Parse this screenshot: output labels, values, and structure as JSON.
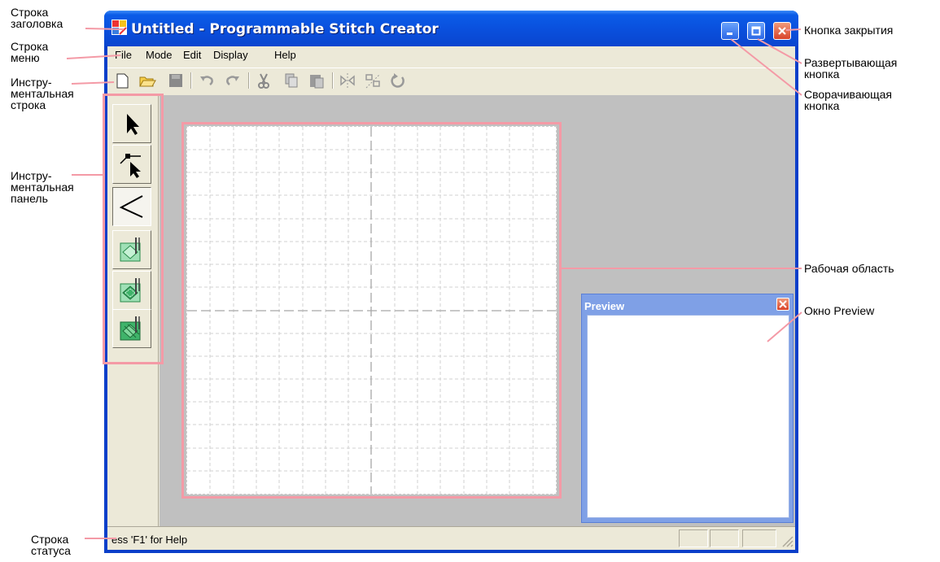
{
  "window": {
    "title": "Untitled - Programmable Stitch Creator",
    "accent_color": "#0a4fdc",
    "caption_buttons": [
      "minimize-icon",
      "maximize-icon",
      "close-icon"
    ]
  },
  "menu": {
    "items": [
      "File",
      "Mode",
      "Edit",
      "Display",
      "Help"
    ]
  },
  "toolbar": {
    "buttons": [
      "new-icon",
      "open-icon",
      "save-icon",
      "undo-icon",
      "redo-icon",
      "cut-icon",
      "copy-icon",
      "paste-icon",
      "flip-horizontal-icon",
      "flip-vertical-icon",
      "rotate-icon"
    ]
  },
  "tool_panel": {
    "tools": [
      "select-arrow-icon",
      "point-edit-icon",
      "zigzag-stitch-icon",
      "stitch-pattern-1-icon",
      "stitch-pattern-2-icon",
      "stitch-pattern-3-icon"
    ],
    "active_index": 2
  },
  "preview": {
    "title": "Preview"
  },
  "status": {
    "text": "ess 'F1' for Help"
  },
  "callouts": {
    "title_bar": [
      "Строка",
      "заголовка"
    ],
    "menu_bar": [
      "Строка",
      "меню"
    ],
    "toolbar": [
      "Инстру-",
      "ментальная",
      "строка"
    ],
    "tool_panel": [
      "Инстру-",
      "ментальная",
      "панель"
    ],
    "status_bar": [
      "Строка",
      "статуса"
    ],
    "close_button": "Кнопка закрытия",
    "maximize_button": [
      "Развертывающая",
      "кнопка"
    ],
    "minimize_button": [
      "Сворачивающая",
      "кнопка"
    ],
    "work_area": "Рабочая область",
    "preview_window": "Окно Preview"
  },
  "highlight_color": "#f49aa6"
}
